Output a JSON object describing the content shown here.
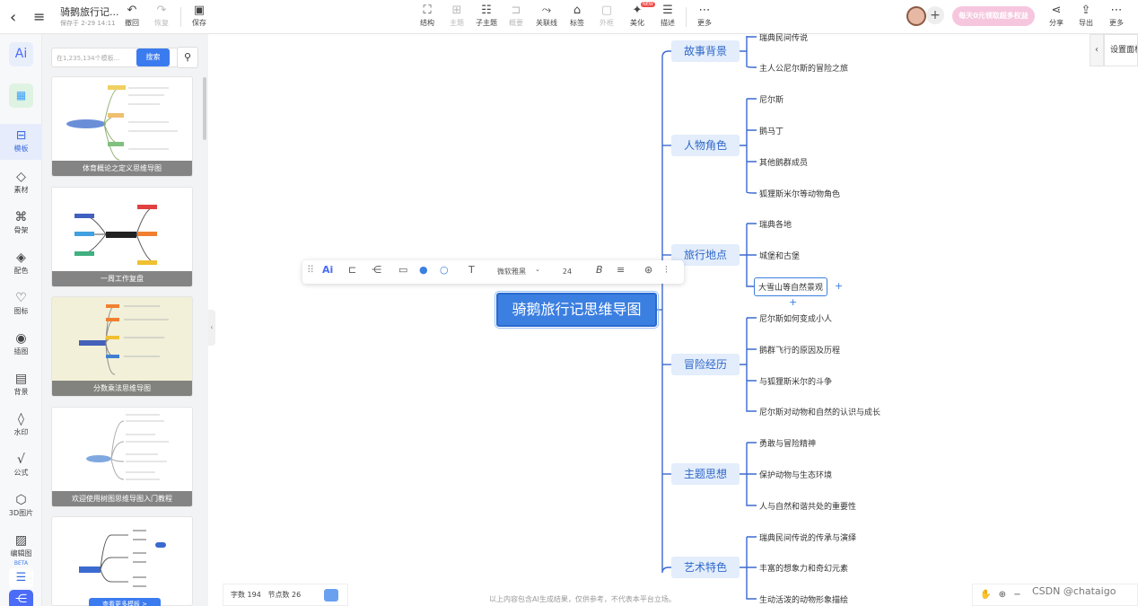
{
  "header": {
    "file_title": "骑鹅旅行记...",
    "saved_at": "保存于 2-29 14:11",
    "back_icon": "chevron-left-icon",
    "menu_icon": "hamburger-icon",
    "undo": "撤回",
    "redo": "恢复",
    "save": "保存",
    "tools": [
      "结构",
      "主题",
      "子主题",
      "概要",
      "关联线",
      "标签",
      "外框",
      "美化",
      "描述",
      "更多"
    ],
    "promo": "每天0元领取超多权益",
    "share": "分享",
    "export": "导出",
    "more": "更多",
    "new_badge": "NEW"
  },
  "iconbar": {
    "ai_label": "Ai",
    "items": [
      "模板",
      "素材",
      "骨架",
      "配色",
      "图标",
      "插图",
      "背景",
      "水印",
      "公式",
      "3D图片",
      "编辑图",
      "BETA"
    ]
  },
  "panel": {
    "search_placeholder": "在1,235,134个模板...",
    "search_button": "搜索",
    "templates": [
      "体育概论之定义思维导图",
      "一周工作复盘",
      "分数乘法思维导图",
      "欢迎使用树图思维导图入门教程"
    ],
    "more_templates": "查看更多模板 >"
  },
  "toolbar_float": {
    "ai": "Ai",
    "font": "微软雅黑",
    "size": "24"
  },
  "mindmap": {
    "root": "骑鹅旅行记思维导图",
    "topics": [
      {
        "label": "故事背景",
        "children": [
          "瑞典民间传说",
          "主人公尼尔斯的冒险之旅"
        ]
      },
      {
        "label": "人物角色",
        "children": [
          "尼尔斯",
          "鹅马丁",
          "其他鹅群成员",
          "狐狸斯米尔等动物角色"
        ]
      },
      {
        "label": "旅行地点",
        "children": [
          "瑞典各地",
          "城堡和古堡",
          "大雪山等自然景观"
        ]
      },
      {
        "label": "冒险经历",
        "children": [
          "尼尔斯如何变成小人",
          "鹅群飞行的原因及历程",
          "与狐狸斯米尔的斗争",
          "尼尔斯对动物和自然的认识与成长"
        ]
      },
      {
        "label": "主题思想",
        "children": [
          "勇敢与冒险精神",
          "保护动物与生态环境",
          "人与自然和谐共处的重要性"
        ]
      },
      {
        "label": "艺术特色",
        "children": [
          "瑞典民间传说的传承与演绎",
          "丰富的想象力和奇幻元素",
          "生动活泼的动物形象描绘"
        ]
      }
    ]
  },
  "right_panel": {
    "label": "设置面板"
  },
  "status": {
    "chars": "字数 194",
    "nodes": "节点数 26"
  },
  "disclaimer": "以上内容包含AI生成结果，仅供参考，不代表本平台立场。",
  "watermark": "CSDN @chataigo",
  "colors": {
    "accent": "#3b7fe0",
    "topic_bg": "#e3edfb",
    "topic_text": "#2f68c8"
  }
}
